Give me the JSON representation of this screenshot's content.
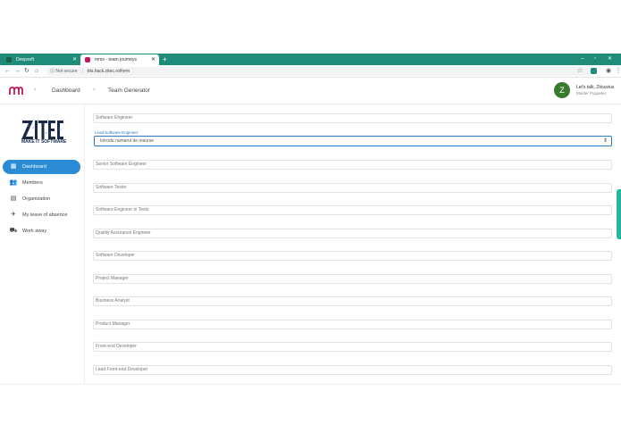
{
  "browser": {
    "tabs": [
      {
        "label": "Deepsoft",
        "active": false
      },
      {
        "label": "mmo - team journeys",
        "active": true
      }
    ],
    "new_tab_icon": "plus-icon",
    "url_security": "Not secure",
    "url": "bts.hack.zitec.ro/form"
  },
  "header": {
    "crumbs": [
      "Dashboard",
      "Team Generator"
    ],
    "user": {
      "initial": "Z",
      "name": "Let's talk, Zitouvius",
      "role": "Master Puppeter"
    }
  },
  "sidebar": {
    "brand_tagline": "MAKE IT SOFTWARE",
    "items": [
      {
        "label": "Dashboard",
        "icon": "grid-icon",
        "active": true
      },
      {
        "label": "Members",
        "icon": "people-icon",
        "active": false
      },
      {
        "label": "Organization",
        "icon": "building-icon",
        "active": false
      },
      {
        "label": "My leave of absence",
        "icon": "airplane-icon",
        "active": false
      },
      {
        "label": "Work away",
        "icon": "travel-icon",
        "active": false
      }
    ]
  },
  "form": {
    "fields": [
      "Software Engineer",
      "Senior Software Engineer",
      "Software Tester",
      "Software Engineer in Tests",
      "Quality Assurance Engineer",
      "Software Developer",
      "Project Manager",
      "Business Analyst",
      "Product Manager",
      "Front-end Developer",
      "Lead Front-end Developer"
    ],
    "focused_label": "Lead Software Engineer",
    "focused_placeholder": "Introdu numarul de resurse"
  },
  "colors": {
    "tabstrip": "#1e8c78",
    "accent": "#2b8bd4",
    "avatar": "#3a7a2e",
    "focus": "#2b7cc4"
  }
}
